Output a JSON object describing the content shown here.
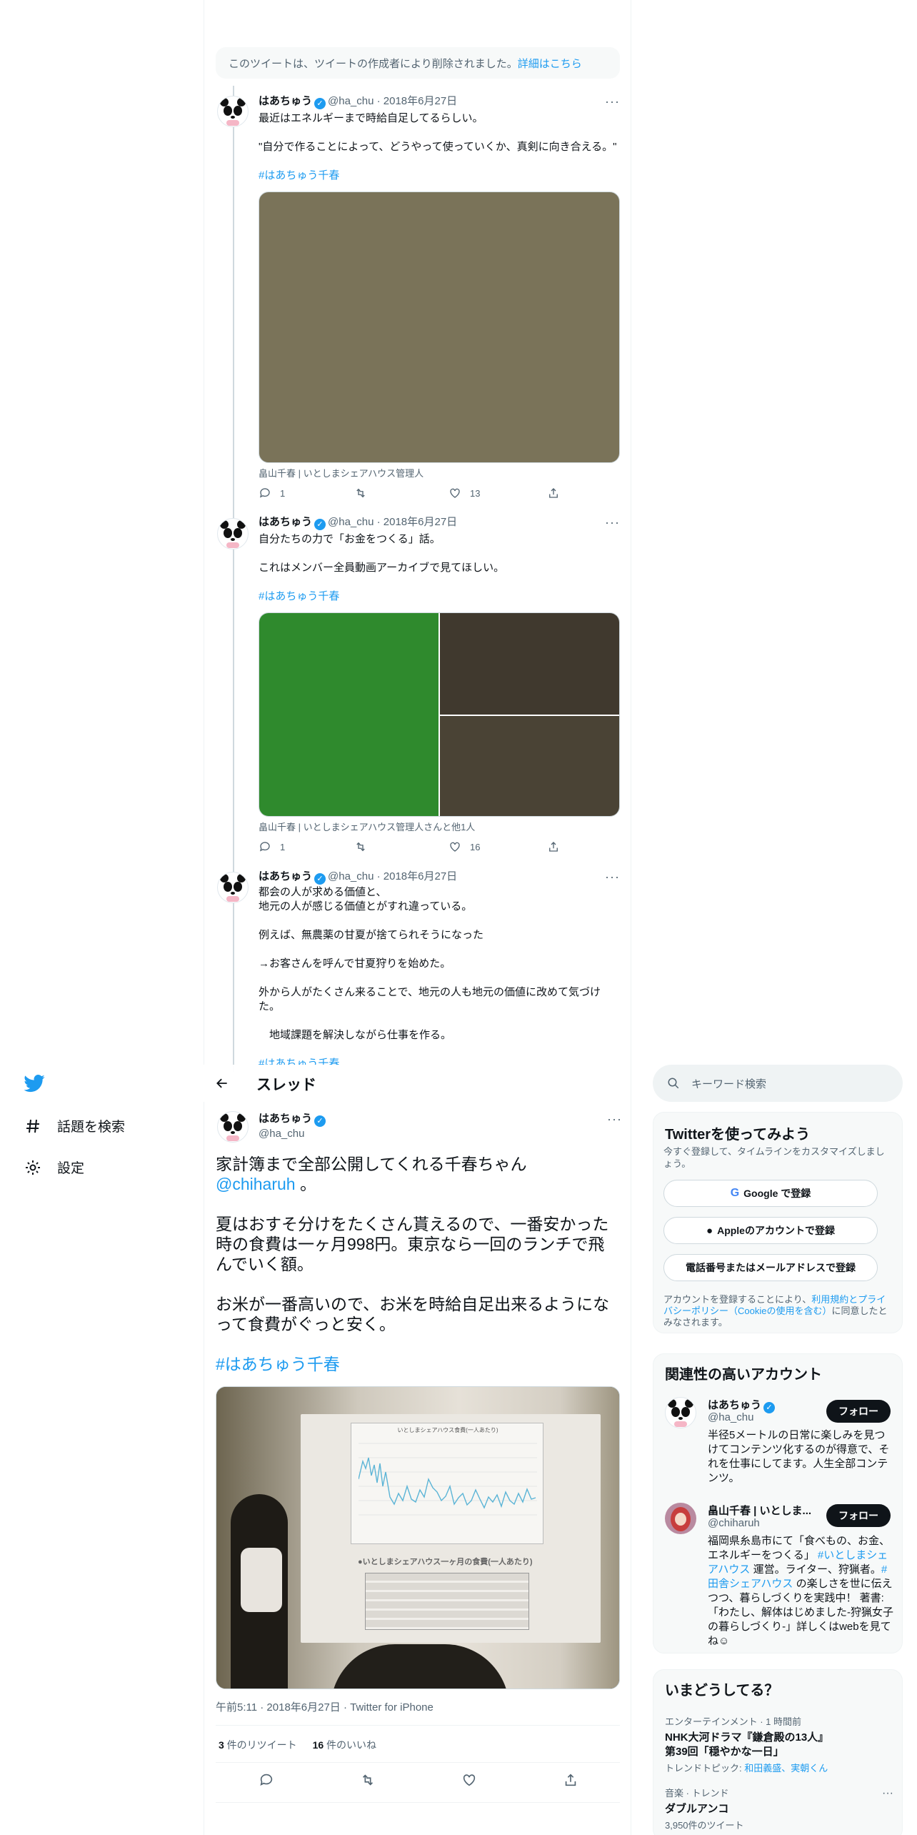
{
  "deleted_notice": {
    "text": "このツイートは、ツイートの作成者により削除されました。",
    "link": "詳細はこちら"
  },
  "user": {
    "name": "はあちゅう",
    "handle": "@ha_chu"
  },
  "thread_tweets": [
    {
      "handle_date": "@ha_chu · 2018年6月27日",
      "lines": [
        "最近はエネルギーまで時給自足してるらしい。",
        "",
        "\"自分で作ることによって、どうやって使っていくか、真剣に向き合える。\""
      ],
      "hashtag": "#はあちゅう千春",
      "caption": "畠山千春 | いとしまシェアハウス管理人",
      "replies": "1",
      "retweets": "",
      "likes": "13"
    },
    {
      "handle_date": "@ha_chu · 2018年6月27日",
      "lines": [
        "自分たちの力で「お金をつくる」話。",
        "",
        "これはメンバー全員動画アーカイブで見てほしい。"
      ],
      "hashtag": "#はあちゅう千春",
      "caption": "畠山千春 | いとしまシェアハウス管理人さんと他1人",
      "replies": "1",
      "retweets": "",
      "likes": "16"
    },
    {
      "handle_date": "@ha_chu · 2018年6月27日",
      "lines": [
        "都会の人が求める価値と、",
        "地元の人が感じる価値とがすれ違っている。",
        "",
        "例えば、無農薬の甘夏が捨てられそうになった",
        "",
        "→お客さんを呼んで甘夏狩りを始めた。",
        "",
        "外から人がたくさん来ることで、地元の人も地元の価値に改めて気づけた。",
        "",
        "　地域課題を解決しながら仕事を作る。"
      ],
      "hashtag": "#はあちゅう千春"
    }
  ],
  "nav": {
    "explore": "話題を検索",
    "settings": "設定"
  },
  "thread_header": {
    "title": "スレッド"
  },
  "main_tweet": {
    "name": "はあちゅう",
    "handle": "@ha_chu",
    "p1": "家計簿まで全部公開してくれる千春ちゃん",
    "mention": "@chiharuh",
    "p1_end": " 。",
    "p2": "夏はおすそ分けをたくさん貰えるので、一番安かった時の食費は一ヶ月998円。東京なら一回のランチで飛んでいく額。",
    "p3": "お米が一番高いので、お米を時給自足出来るようになって食費がぐっと安く。",
    "hashtag": "#はあちゅう千春",
    "meta": "午前5:11 · 2018年6月27日 · Twitter for iPhone",
    "retweet_count": "3",
    "retweet_label": " 件のリツイート",
    "like_count": "16",
    "like_label": " 件のいいね"
  },
  "slide": {
    "chart_title": "いとしまシェアハウス食費(一人あたり)",
    "table_title": "●いとしまシェアハウス一ヶ月の食費(一人あたり)"
  },
  "search": {
    "placeholder": "キーワード検索"
  },
  "signup": {
    "title": "Twitterを使ってみよう",
    "subtitle": "今すぐ登録して、タイムラインをカスタマイズしましょう。",
    "google": "Google で登録",
    "apple": "Appleのアカウントで登録",
    "phone": "電話番号またはメールアドレスで登録",
    "terms_pre": "アカウントを登録することにより、",
    "terms_link": "利用規約とプライバシーポリシー（Cookieの使用を含む）",
    "terms_post": "に同意したとみなされます。"
  },
  "related": {
    "title": "関連性の高いアカウント",
    "follow": "フォロー",
    "accounts": [
      {
        "name": "はあちゅう",
        "handle": "@ha_chu",
        "bio": "半径5メートルの日常に楽しみを見つけてコンテンツ化するのが得意で、それを仕事にしてます。人生全部コンテンツ。"
      },
      {
        "name": "畠山千春 | いとしま...",
        "handle": "@chiharuh",
        "bio_1": "福岡県糸島市にて「食べもの、お金、エネルギーをつくる」",
        "tag_1": "#いとしまシェアハウス",
        "bio_2": "運営。ライター、狩猟者。",
        "tag_2": "#田舎シェアハウス",
        "bio_3": "の楽しさを世に伝えつつ、暮らしづくりを実践中！ 著書:「わたし、解体はじめました-狩猟女子の暮らしづくり-」詳しくはwebを見てね☺"
      }
    ]
  },
  "trends": {
    "title": "いまどうしてる？",
    "items": [
      {
        "context": "エンターテインメント · 1 時間前",
        "title_1": "NHK大河ドラマ『鎌倉殿の13人』",
        "title_2": "第39回「穏やかな一日」",
        "topic_label": "トレンドトピック: ",
        "topic_links": "和田義盛、実朝くん"
      },
      {
        "context": "音楽 · トレンド",
        "title_1": "ダブルアンコ",
        "count": "3,950件のツイート"
      }
    ]
  },
  "colors": {
    "accent": "#1d9bf0",
    "text": "#0f1419",
    "secondary": "#536471"
  }
}
